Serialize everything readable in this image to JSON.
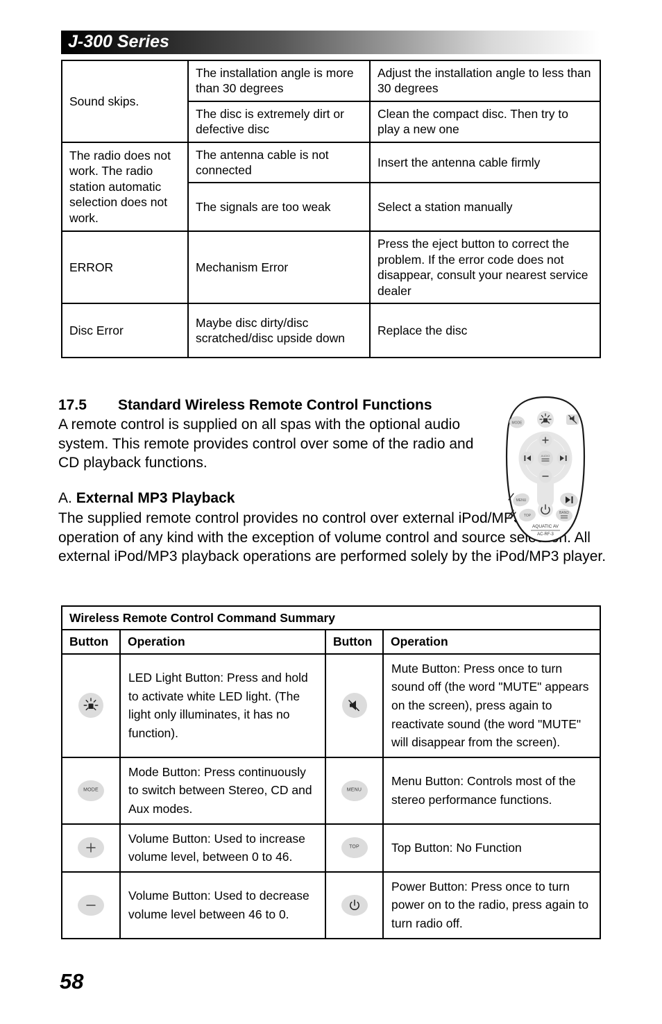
{
  "header": {
    "title": "J-300 Series"
  },
  "troubleshooting_table": {
    "rows": [
      {
        "symptom": "Sound skips.",
        "symptom_rowspan": 2,
        "cause": "The installation angle is more than 30 degrees",
        "remedy": "Adjust the installation angle to less than 30 degrees"
      },
      {
        "symptom": null,
        "cause": "The disc is extremely dirt or defective disc",
        "remedy": "Clean the compact disc. Then try to play a new one"
      },
      {
        "symptom": "The radio does not work. The radio station automatic selection does not work.",
        "symptom_rowspan": 2,
        "cause": "The antenna cable is not connected",
        "remedy": "Insert the antenna cable firmly"
      },
      {
        "symptom": null,
        "cause": "The signals are too weak",
        "remedy": "Select a station manually"
      },
      {
        "symptom": "ERROR",
        "symptom_rowspan": 1,
        "cause": "Mechanism Error",
        "remedy": "Press the eject button to correct the problem. If the error code does not disappear, consult your nearest service dealer"
      },
      {
        "symptom": "Disc Error",
        "symptom_rowspan": 1,
        "cause": "Maybe disc dirty/disc scratched/disc upside down",
        "remedy": "Replace the disc"
      }
    ]
  },
  "section": {
    "number": "17.5",
    "title": "Standard Wireless Remote Control Functions",
    "paragraph": "A remote control is supplied on all spas with the optional audio system. This remote provides control over some of the radio and CD playback functions."
  },
  "subsection": {
    "label": "A.",
    "title": "External MP3 Playback",
    "paragraph": "The supplied remote control provides no control over external iPod/MP3 player operation of any kind with the exception of volume control and source selection. All external iPod/MP3 playback operations are performed solely by the iPod/MP3 player."
  },
  "remote_figure": {
    "name": "wireless-remote-control",
    "brand": "AQUATIC AV",
    "model": "AC-RF-3",
    "buttons": [
      "MODE",
      "LED",
      "MUTE",
      "+",
      "PREV",
      "MENU",
      "NEXT",
      "−",
      "MENU",
      "TOP",
      "POWER",
      "PLAY/PAUSE",
      "BAND"
    ]
  },
  "command_summary": {
    "title": "Wireless Remote Control Command Summary",
    "headers": {
      "button": "Button",
      "operation": "Operation"
    },
    "rows": [
      {
        "left": {
          "icon": "led-light-icon",
          "icon_label": "",
          "operation": "LED Light Button: Press and hold to activate white LED light. (The light only illuminates, it has no function)."
        },
        "right": {
          "icon": "mute-icon",
          "icon_label": "",
          "operation": "Mute Button: Press once to turn sound off (the word \"MUTE\" appears on the screen), press again to reactivate sound (the word \"MUTE\" will disappear from the screen)."
        }
      },
      {
        "left": {
          "icon": "mode-button-icon",
          "icon_label": "MODE",
          "operation": "Mode Button: Press continuously to switch between Stereo, CD and Aux modes."
        },
        "right": {
          "icon": "menu-button-icon",
          "icon_label": "MENU",
          "operation": "Menu Button: Controls most of the stereo performance functions."
        }
      },
      {
        "left": {
          "icon": "volume-up-icon",
          "icon_label": "",
          "operation": "Volume Button: Used to increase volume level, between 0 to 46."
        },
        "right": {
          "icon": "top-button-icon",
          "icon_label": "TOP",
          "operation": "Top Button: No Function"
        }
      },
      {
        "left": {
          "icon": "volume-down-icon",
          "icon_label": "",
          "operation": "Volume Button: Used to decrease volume level between 46 to 0."
        },
        "right": {
          "icon": "power-icon",
          "icon_label": "",
          "operation": "Power Button: Press once to turn power on to the radio, press again to turn radio off."
        }
      }
    ]
  },
  "footer": {
    "page_number": "58"
  },
  "colors": {
    "text": "#000000",
    "border": "#000000",
    "chip_fill": "#dcdcdc",
    "header_gradient_start": "#000000",
    "header_gradient_end": "#ffffff"
  }
}
